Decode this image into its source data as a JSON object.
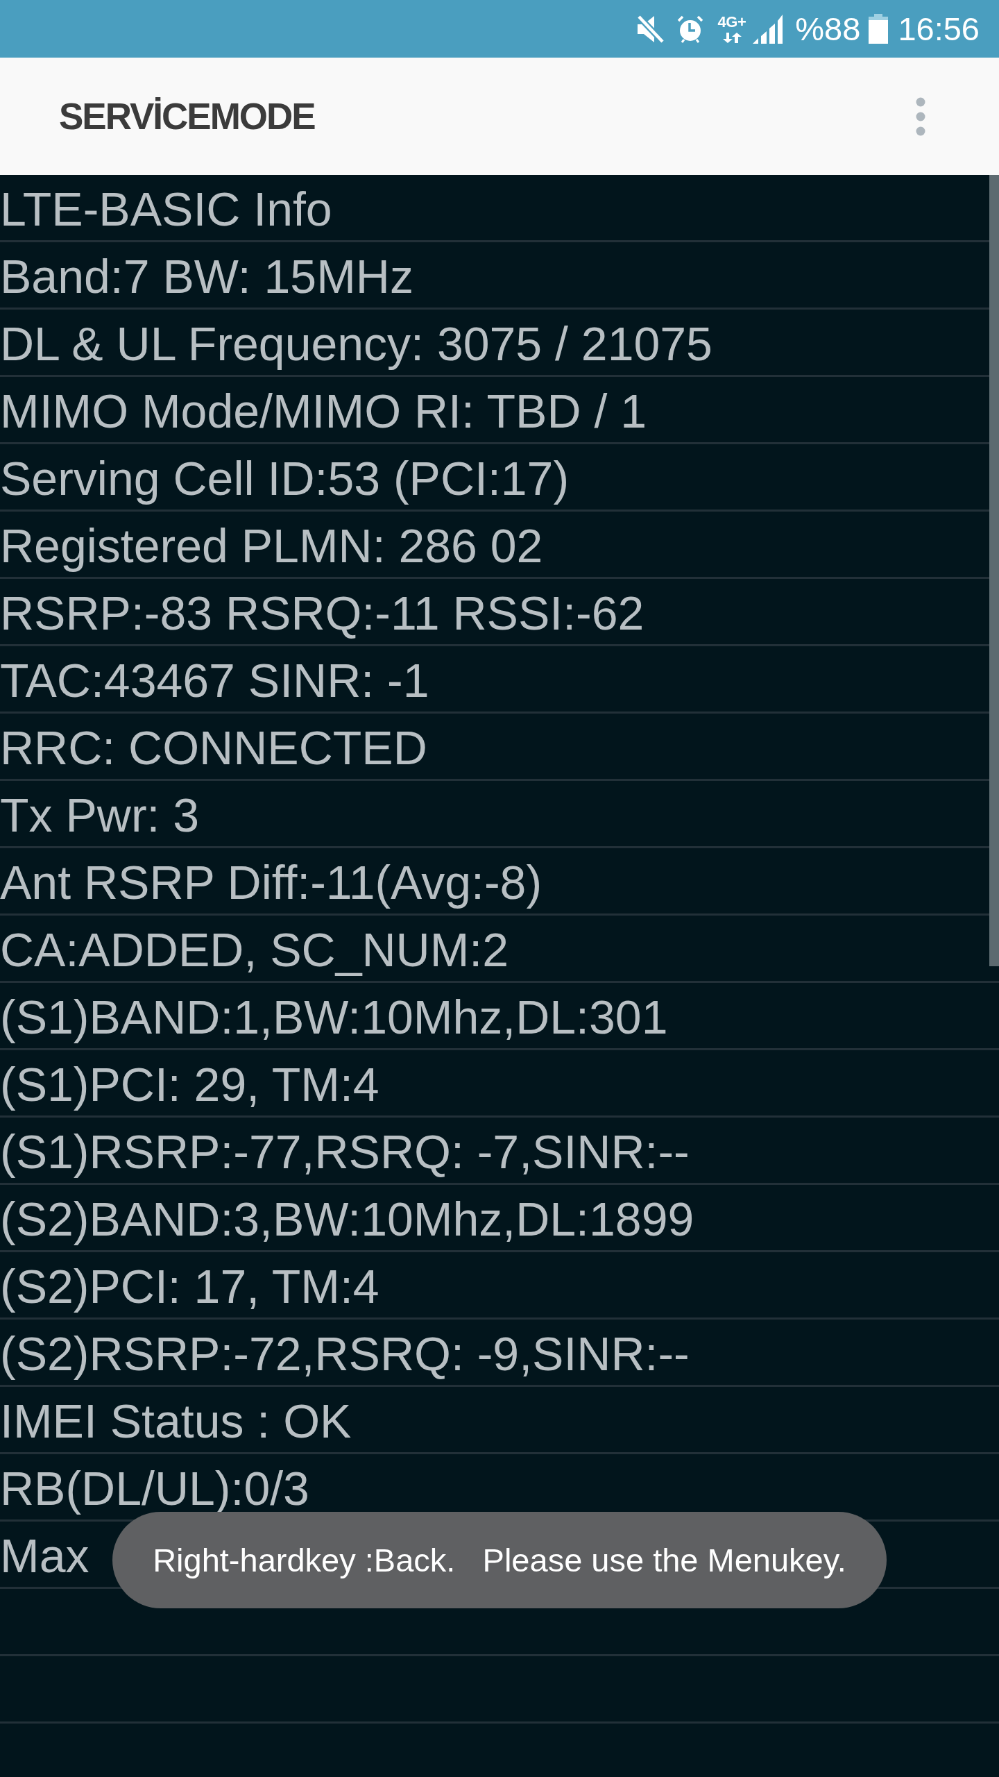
{
  "status_bar": {
    "network": "4G+",
    "battery": "%88",
    "time": "16:56"
  },
  "app_bar": {
    "title": "SERVİCEMODE"
  },
  "rows": [
    "LTE-BASIC Info",
    "Band:7 BW: 15MHz",
    "DL & UL Frequency: 3075 / 21075",
    "MIMO Mode/MIMO RI: TBD / 1",
    "Serving Cell ID:53 (PCI:17)",
    "Registered PLMN: 286 02",
    "RSRP:-83 RSRQ:-11 RSSI:-62",
    "TAC:43467 SINR: -1",
    "RRC: CONNECTED",
    "Tx Pwr: 3",
    "Ant RSRP Diff:-11(Avg:-8)",
    "CA:ADDED, SC_NUM:2",
    "(S1)BAND:1,BW:10Mhz,DL:301",
    "(S1)PCI: 29, TM:4",
    "(S1)RSRP:-77,RSRQ: -7,SINR:--",
    "(S2)BAND:3,BW:10Mhz,DL:1899",
    "(S2)PCI: 17, TM:4",
    "(S2)RSRP:-72,RSRQ: -9,SINR:--",
    "IMEI Status : OK",
    "RB(DL/UL):0/3",
    "Max"
  ],
  "toast": {
    "text": "Right-hardkey :Back.   Please use the Menukey."
  }
}
